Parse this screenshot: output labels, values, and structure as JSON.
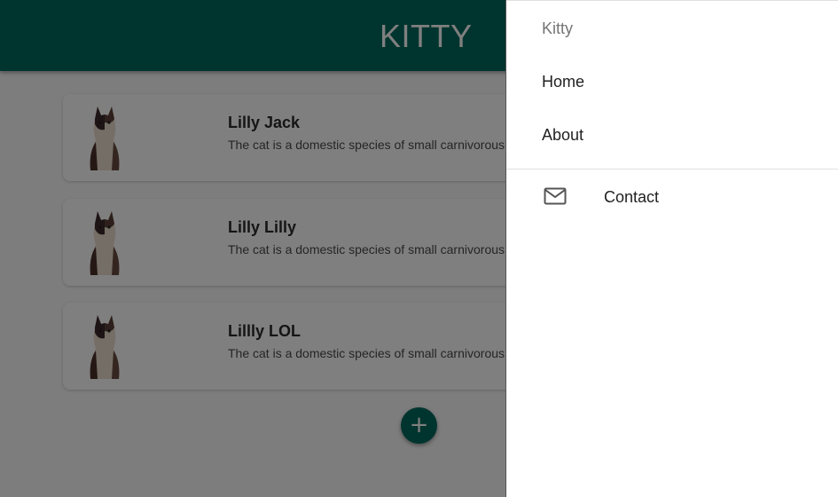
{
  "appbar": {
    "title": "KITTY"
  },
  "cards": [
    {
      "title": "Lilly Jack",
      "description": "The cat is a domestic species of small carnivorous m"
    },
    {
      "title": "Lilly Lilly",
      "description": "The cat is a domestic species of small carnivorous m"
    },
    {
      "title": "Lillly LOL",
      "description": "The cat is a domestic species of small carnivorous m"
    }
  ],
  "fab": {
    "icon": "plus-icon",
    "label": "+"
  },
  "drawer": {
    "header": "Kitty",
    "items": [
      {
        "label": "Home"
      },
      {
        "label": "About"
      }
    ],
    "contact": {
      "label": "Contact",
      "icon": "mail-icon"
    }
  },
  "colors": {
    "primary": "#00695c",
    "scrim": "rgba(0,0,0,0.5)"
  }
}
